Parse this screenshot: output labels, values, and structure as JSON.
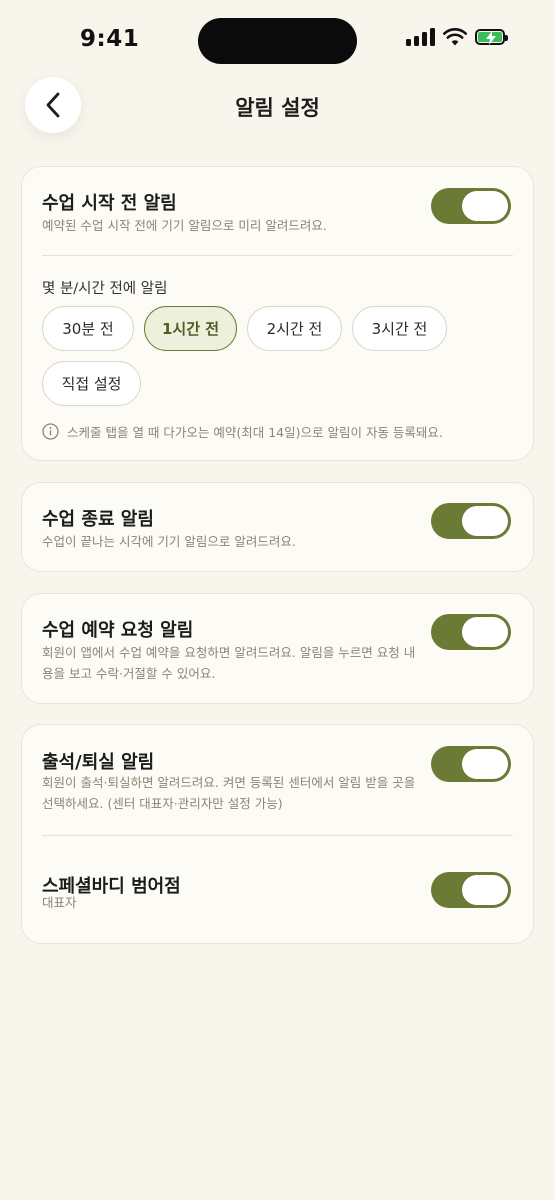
{
  "status_bar": {
    "time": "9:41"
  },
  "header": {
    "title": "알림 설정"
  },
  "class_start": {
    "title": "수업 시작 전 알림",
    "description": "예약된 수업 시작 전에 기기 알림으로 미리 알려드려요.",
    "enabled": true,
    "timing_label": "몇 분/시간 전에 알림",
    "options": [
      "30분 전",
      "1시간 전",
      "2시간 전",
      "3시간 전",
      "직접 설정"
    ],
    "selected_option": "1시간 전",
    "info": "스케줄 탭을 열 때 다가오는 예약(최대 14일)으로 알림이 자동 등록돼요."
  },
  "class_end": {
    "title": "수업 종료 알림",
    "description": "수업이 끝나는 시각에 기기 알림으로 알려드려요.",
    "enabled": true
  },
  "booking_request": {
    "title": "수업 예약 요청 알림",
    "description": "회원이 앱에서 수업 예약을 요청하면 알려드려요. 알림을 누르면 요청 내용을 보고 수락·거절할 수 있어요.",
    "enabled": true
  },
  "attendance": {
    "title": "출석/퇴실 알림",
    "description": "회원이 출석·퇴실하면 알려드려요. 켜면 등록된 센터에서 알림 받을 곳을 선택하세요. (센터 대표자·관리자만 설정 가능)",
    "enabled": true,
    "center": {
      "name": "스페셜바디 범어점",
      "role": "대표자",
      "enabled": true
    }
  },
  "colors": {
    "accent": "#6b7a35",
    "background": "#f8f5ec",
    "battery": "#3dbb5a"
  }
}
